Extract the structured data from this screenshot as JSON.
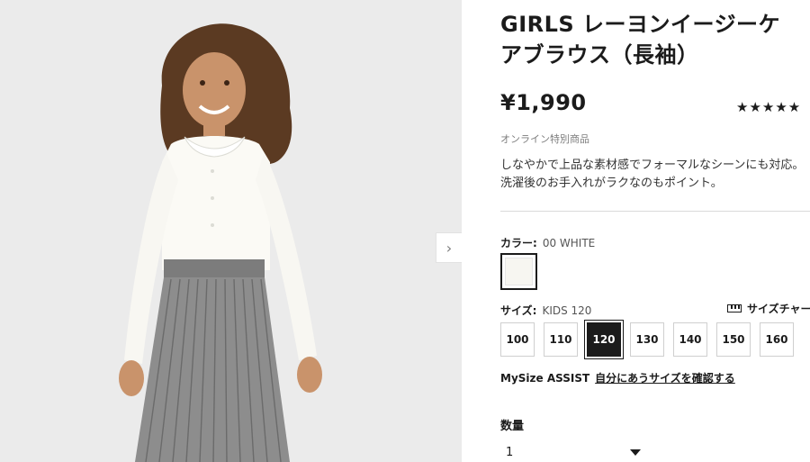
{
  "product": {
    "title_line1": "GIRLS レーヨンイージーケ",
    "title_line2": "アブラウス（長袖）",
    "price": "¥1,990",
    "rating_stars": "★★★★★",
    "online_label": "オンライン特別商品",
    "description_line1": "しなやかで上品な素材感でフォーマルなシーンにも対応。",
    "description_line2": "洗濯後のお手入れがラクなのもポイント。"
  },
  "gallery": {
    "next_arrow": "›"
  },
  "color": {
    "label": "カラー:",
    "value": "00 WHITE",
    "swatch_color": "#f7f6f1"
  },
  "size": {
    "label": "サイズ:",
    "value": "KIDS 120",
    "chart_link": "サイズチャート",
    "options": [
      "100",
      "110",
      "120",
      "130",
      "140",
      "150",
      "160"
    ],
    "selected": "120"
  },
  "mysize": {
    "label": "MySize ASSIST",
    "link": "自分にあうサイズを確認する"
  },
  "quantity": {
    "label": "数量",
    "value": "1"
  }
}
